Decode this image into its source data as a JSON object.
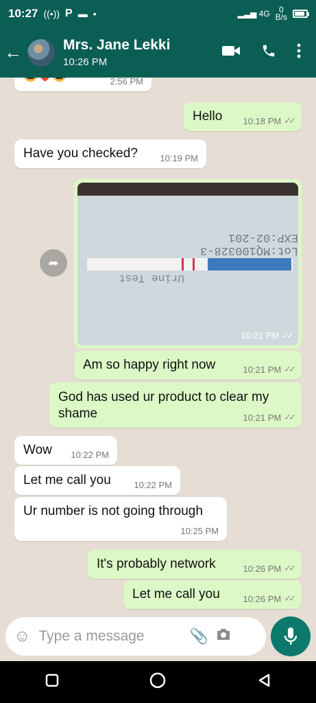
{
  "status": {
    "time": "10:27",
    "net": "0",
    "unit": "B/s",
    "signal": "4G"
  },
  "header": {
    "name": "Mrs. Jane Lekki",
    "subtitle": "10:26 PM"
  },
  "messages": [
    {
      "text": "😂❤️😂",
      "time": "2:56 PM"
    },
    {
      "text": "Hello",
      "time": "10:18 PM"
    },
    {
      "text": "Have you checked?",
      "time": "10:19 PM"
    },
    {
      "image_time": "10:21 PM"
    },
    {
      "text": "Am so happy right now",
      "time": "10:21 PM"
    },
    {
      "text": "God has used ur product to clear my shame",
      "time": "10:21 PM"
    },
    {
      "text": "Wow",
      "time": "10:22 PM"
    },
    {
      "text": "Let me call you",
      "time": "10:22 PM"
    },
    {
      "text": "Ur number is not going through",
      "time": "10:25 PM"
    },
    {
      "text": "It's probably network",
      "time": "10:26 PM"
    },
    {
      "text": "Let me call you",
      "time": "10:26 PM"
    }
  ],
  "photo": {
    "printed_top": "Lot:MQ100328-3 EXP:02-201",
    "printed_bottom": "Urine Test"
  },
  "input": {
    "placeholder": "Type a message"
  },
  "colors": {
    "header": "#0b5e54",
    "outgoing": "#dcf8c6",
    "incoming": "#ffffff",
    "mic": "#0b7a6c"
  }
}
